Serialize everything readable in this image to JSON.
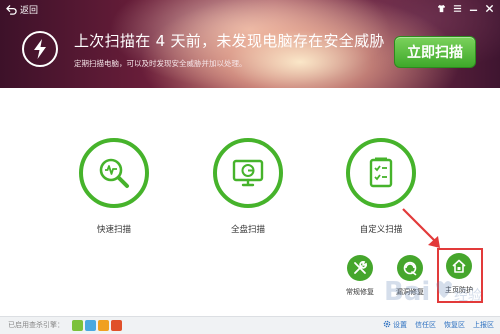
{
  "header": {
    "back_label": "返回",
    "headline": "上次扫描在 4 天前，未发现电脑存在安全威胁",
    "subline": "定期扫描电脑，可以及时发现安全威胁并加以处理。",
    "scan_now_label": "立即扫描",
    "window_controls": [
      "shirt-icon",
      "menu-icon",
      "minimize-icon",
      "close-icon"
    ]
  },
  "scan_options": [
    {
      "label": "快速扫描",
      "icon": "quick-scan-icon"
    },
    {
      "label": "全盘扫描",
      "icon": "monitor-icon"
    },
    {
      "label": "自定义扫描",
      "icon": "checklist-icon"
    }
  ],
  "tools": [
    {
      "label": "常规修复",
      "icon": "wrench-screwdriver-icon"
    },
    {
      "label": "漏洞修复",
      "icon": "vulnerability-icon"
    },
    {
      "label": "主页防护",
      "icon": "home-lock-icon"
    }
  ],
  "statusbar": {
    "engine_label": "已启用查杀引擎：",
    "links": [
      "设置",
      "信任区",
      "恢复区",
      "上报区"
    ]
  },
  "colors": {
    "accent_green": "#46b32b",
    "button_green": "#3ea82a",
    "annotation_red": "#e23a3a",
    "link_blue": "#2a6fc0",
    "engine_icon_colors": [
      "#7cc13a",
      "#4aa8e0",
      "#f0a020",
      "#e0502a"
    ]
  }
}
